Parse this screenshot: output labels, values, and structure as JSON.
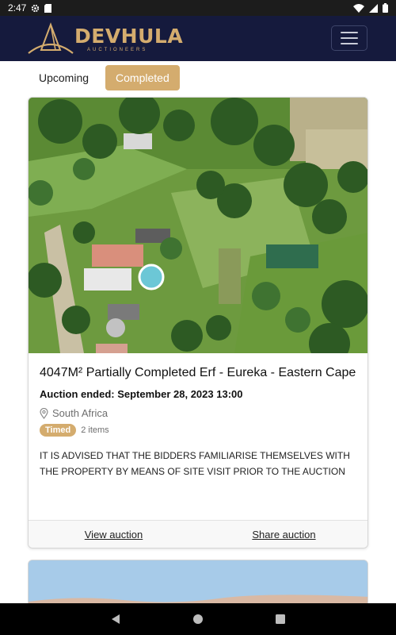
{
  "status_bar": {
    "time": "2:47",
    "icons": [
      "settings-icon",
      "sd-card-icon",
      "wifi-icon",
      "signal-icon",
      "battery-icon"
    ]
  },
  "header": {
    "brand_name": "DEVHULA",
    "brand_subtitle": "AUCTIONEERS",
    "menu_icon": "hamburger-icon"
  },
  "tabs": [
    {
      "label": "Upcoming",
      "active": false
    },
    {
      "label": "Completed",
      "active": true
    }
  ],
  "auctions": [
    {
      "title": "4047M² Partially Completed Erf - Eureka - Eastern Cape",
      "ended": "Auction ended: September 28, 2023 13:00",
      "location": "South Africa",
      "badge": "Timed",
      "items_count": "2 items",
      "description": "IT IS ADVISED THAT THE BIDDERS FAMILIARISE THEMSELVES WITH THE PROPERTY BY MEANS OF SITE VISIT PRIOR TO THE AUCTION",
      "view_label": "View auction",
      "share_label": "Share auction"
    }
  ],
  "colors": {
    "brand_gold": "#d4ac6e",
    "header_navy": "#151a3d"
  },
  "nav_bar": {
    "icons": [
      "back-icon",
      "home-icon",
      "recents-icon"
    ]
  }
}
